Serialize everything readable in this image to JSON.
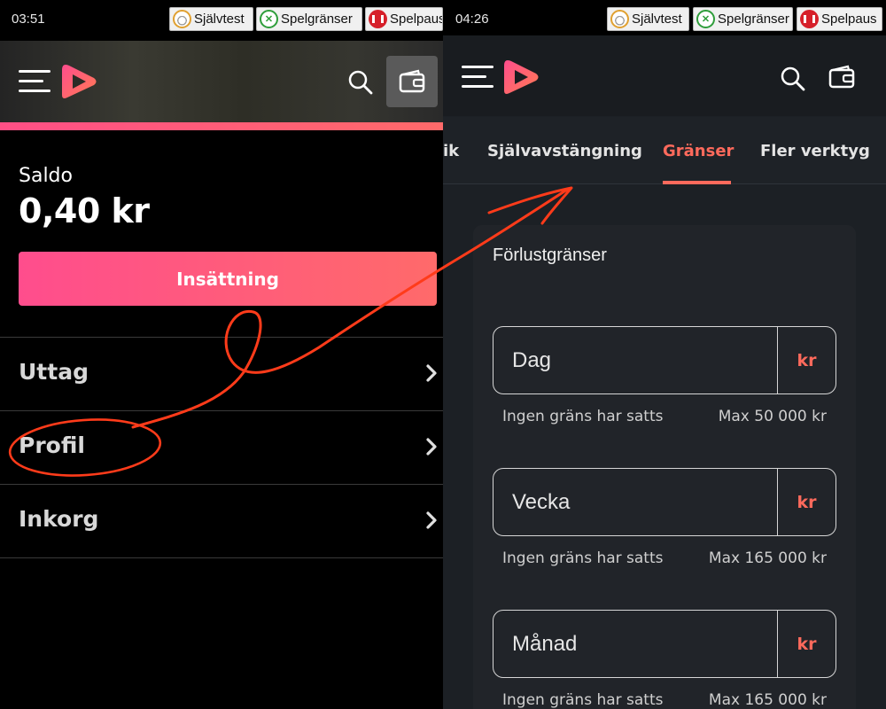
{
  "left": {
    "status": {
      "time": "03:51",
      "buttons": [
        {
          "label": "Självtest",
          "icon": "gauge-icon"
        },
        {
          "label": "Spelgränser",
          "icon": "limit-icon"
        },
        {
          "label": "Spelpaus",
          "icon": "pause-icon"
        }
      ]
    },
    "saldo_label": "Saldo",
    "saldo_value": "0,40 kr",
    "deposit_label": "Insättning",
    "menu": [
      {
        "label": "Uttag"
      },
      {
        "label": "Profil"
      },
      {
        "label": "Inkorg"
      }
    ]
  },
  "right": {
    "status": {
      "time": "04:26",
      "buttons": [
        {
          "label": "Självtest",
          "icon": "gauge-icon"
        },
        {
          "label": "Spelgränser",
          "icon": "limit-icon"
        },
        {
          "label": "Spelpaus",
          "icon": "pause-icon"
        }
      ]
    },
    "tabs": [
      {
        "label": "ik"
      },
      {
        "label": "Självavstängning"
      },
      {
        "label": "Gränser",
        "active": true
      },
      {
        "label": "Fler verktyg"
      }
    ],
    "card_title": "Förlustgränser",
    "limits": [
      {
        "placeholder": "Dag",
        "unit": "kr",
        "status": "Ingen gräns har satts",
        "max": "Max 50 000 kr"
      },
      {
        "placeholder": "Vecka",
        "unit": "kr",
        "status": "Ingen gräns har satts",
        "max": "Max 165 000 kr"
      },
      {
        "placeholder": "Månad",
        "unit": "kr",
        "status": "Ingen gräns har satts",
        "max": "Max 165 000 kr"
      }
    ]
  },
  "colors": {
    "accent": "#ff6a5c",
    "brand_pink": "#ff4d8d",
    "annotation": "#ff3b1a"
  }
}
